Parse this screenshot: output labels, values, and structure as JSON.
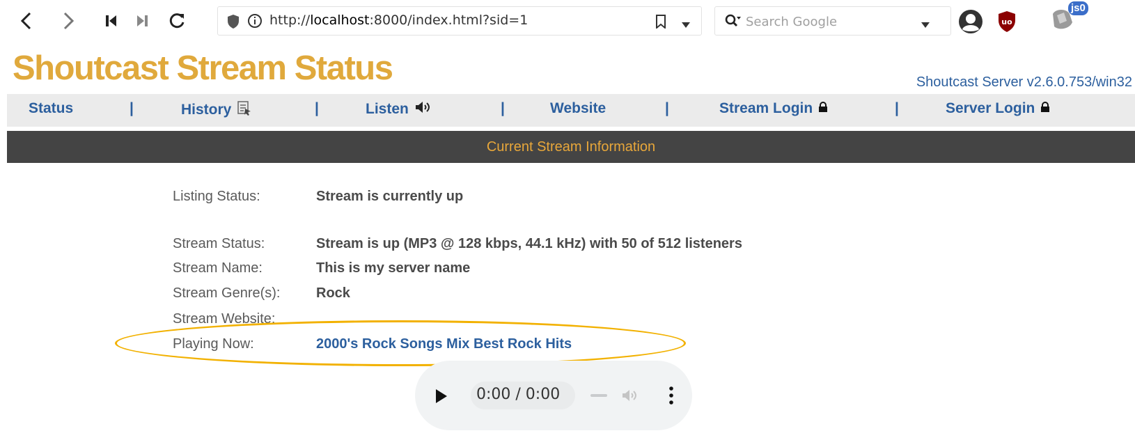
{
  "browser": {
    "url_prefix": "http://",
    "url_host": "localhost",
    "url_rest": ":8000/index.html?sid=1",
    "search_placeholder": "Search Google",
    "ext_badge": "js0"
  },
  "header": {
    "title": "Shoutcast Stream Status",
    "server_version": "Shoutcast Server v2.6.0.753/win32"
  },
  "nav": {
    "status": "Status",
    "history": "History",
    "listen": "Listen",
    "website": "Website",
    "stream_login": "Stream Login",
    "server_login": "Server Login",
    "separator": "|"
  },
  "section": {
    "title": "Current Stream Information"
  },
  "info": {
    "listing_status_label": "Listing Status:",
    "listing_status_value": "Stream is currently up",
    "stream_status_label": "Stream Status:",
    "stream_status_value": "Stream is up (MP3 @ 128 kbps, 44.1 kHz) with 50 of 512 listeners",
    "stream_name_label": "Stream Name:",
    "stream_name_value": "This is my server name",
    "stream_genre_label": "Stream Genre(s):",
    "stream_genre_value": "Rock",
    "stream_website_label": "Stream Website:",
    "stream_website_value": "",
    "playing_now_label": "Playing Now:",
    "playing_now_value": "2000's Rock Songs Mix Best Rock Hits"
  },
  "player": {
    "time": "0:00 / 0:00"
  },
  "colors": {
    "title": "#e0a93c",
    "link": "#2c5f9e",
    "section_bg": "#444444",
    "section_text": "#e8a73a",
    "highlight_ellipse": "#f2b100"
  }
}
